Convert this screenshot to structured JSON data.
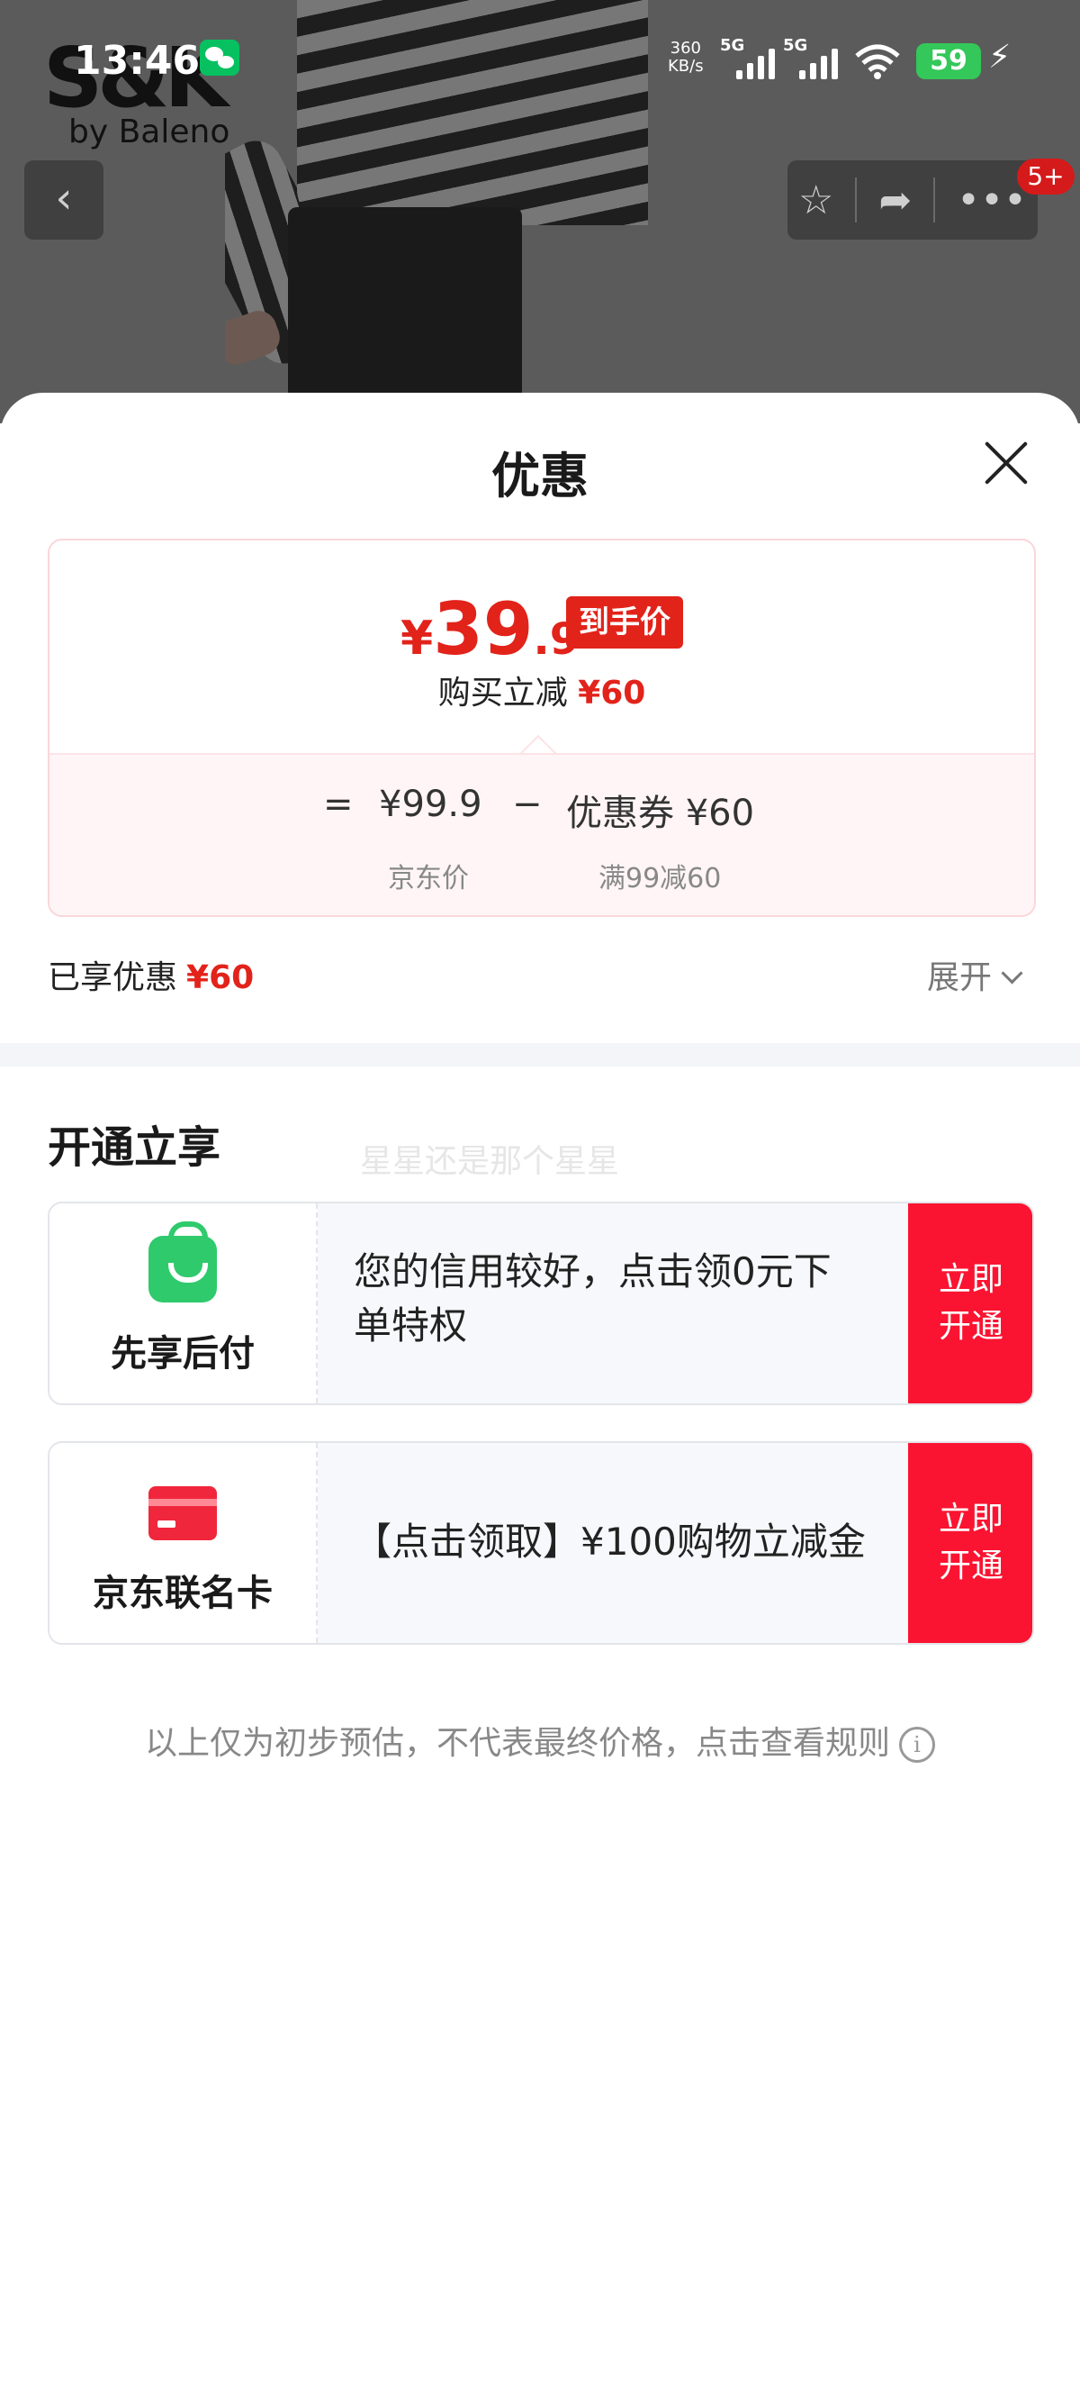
{
  "status_bar": {
    "time": "13:46",
    "net_speed_value": "360",
    "net_speed_unit": "KB/s",
    "signal1_label": "5G",
    "signal2_label": "5G",
    "battery": "59"
  },
  "background": {
    "brand_big": "S&K",
    "brand_sub": "by Baleno"
  },
  "nav": {
    "back_icon": "‹",
    "badge": "5+"
  },
  "sheet": {
    "title": "优惠",
    "price": {
      "currency": "¥",
      "integer": "39",
      "decimal": ".9",
      "tag": "到手价",
      "reduce_text": "购买立减",
      "reduce_amount": "¥60"
    },
    "breakdown": {
      "equals": "=",
      "jd_price": "¥99.9",
      "minus": "−",
      "coupon": "优惠券 ¥60",
      "jd_price_label": "京东价",
      "coupon_label": "满99减60"
    },
    "enjoyed_label": "已享优惠",
    "enjoyed_amount": "¥60",
    "expand_label": "展开",
    "section_title": "开通立享",
    "watermark": "星星还是那个星星",
    "offers": [
      {
        "name": "先享后付",
        "desc": "您的信用较好，点击领0元下单特权",
        "button": "立即开通"
      },
      {
        "name": "京东联名卡",
        "desc": "【点击领取】¥100购物立减金",
        "button": "立即开通"
      }
    ],
    "disclaimer": "以上仅为初步预估，不代表最终价格，点击查看规则"
  },
  "colors": {
    "accent_red": "#e2231a",
    "button_red": "#fa1431",
    "green_bag": "#2fca6c"
  }
}
